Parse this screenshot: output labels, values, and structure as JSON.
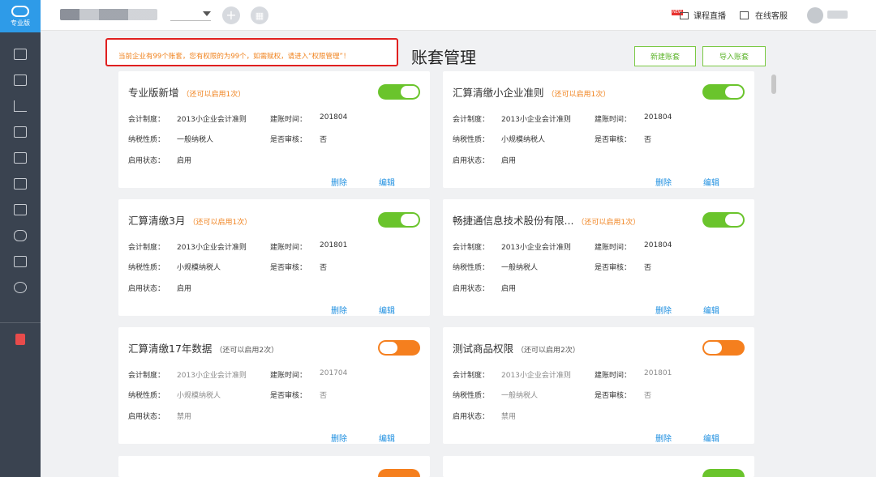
{
  "sidebar": {
    "logo_label": "专业版",
    "items": [
      "voucher",
      "ledger",
      "report",
      "assets",
      "calendar",
      "tax",
      "invoice",
      "salary",
      "audit",
      "settings"
    ],
    "bottom_item": "gift-box"
  },
  "topbar": {
    "live_badge": "NEW",
    "live_label": "课程直播",
    "service_label": "在线客服"
  },
  "header": {
    "notice": "当前企业有99个账套，您有权限的为99个，如需赋权，请进入“权限管理”！",
    "title": "账套管理",
    "new_button": "新建账套",
    "import_button": "导入账套"
  },
  "labels": {
    "accounting_system": "会计制度：",
    "created": "建账时间：",
    "tax_type": "纳税性质：",
    "audit": "是否审核：",
    "status": "启用状态：",
    "delete": "删除",
    "edit": "编辑"
  },
  "cards": [
    {
      "name": "专业版新增",
      "hint": "（还可以启用1次）",
      "system": "2013小企业会计准则",
      "created": "201804",
      "tax": "一般纳税人",
      "audit": "否",
      "status": "启用",
      "enabled": true
    },
    {
      "name": "汇算清缴小企业准则",
      "hint": "（还可以启用1次）",
      "system": "2013小企业会计准则",
      "created": "201804",
      "tax": "小规模纳税人",
      "audit": "否",
      "status": "启用",
      "enabled": true
    },
    {
      "name": "汇算清缴3月",
      "hint": "（还可以启用1次）",
      "system": "2013小企业会计准则",
      "created": "201801",
      "tax": "小规模纳税人",
      "audit": "否",
      "status": "启用",
      "enabled": true
    },
    {
      "name": "畅捷通信息技术股份有限...",
      "hint": "（还可以启用1次）",
      "system": "2013小企业会计准则",
      "created": "201804",
      "tax": "一般纳税人",
      "audit": "否",
      "status": "启用",
      "enabled": true
    },
    {
      "name": "汇算清缴17年数据",
      "hint": "（还可以启用2次）",
      "system": "2013小企业会计准则",
      "created": "201704",
      "tax": "小规模纳税人",
      "audit": "否",
      "status": "禁用",
      "enabled": false
    },
    {
      "name": "测试商品权限",
      "hint": "（还可以启用2次）",
      "system": "2013小企业会计准则",
      "created": "201801",
      "tax": "一般纳税人",
      "audit": "否",
      "status": "禁用",
      "enabled": false
    }
  ]
}
